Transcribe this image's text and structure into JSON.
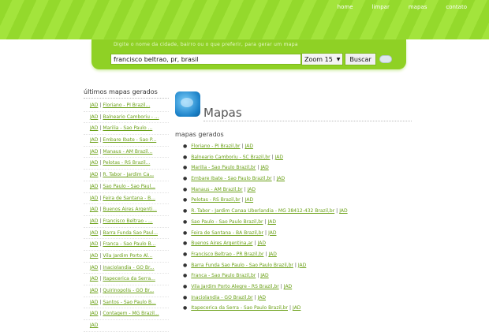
{
  "nav": [
    "home",
    "limpar",
    "mapas",
    "contato"
  ],
  "search": {
    "hint": "Digite o nome da cidade, bairro ou o que preferir, para gerar um mapa",
    "value": "francisco beltrao, pr, brasil",
    "zoom": "Zoom 15",
    "button": "Buscar"
  },
  "sidebar": {
    "title": "últimos mapas gerados",
    "link_label": "JAD",
    "items": [
      "Floriano - PI Brazil...",
      "Balneario Camboriu - ...",
      "Marilia - Sao Paulo ...",
      "Embare Ibate - Sao P...",
      "Manaus - AM Brazil...",
      "Pelotas - RS Brazil...",
      "R. Tabor - Jardim Ca...",
      "Sao Paulo - Sao Paul...",
      "Feira de Santana - B...",
      "Buenos Aires Argenti...",
      "Francisco Beltrao - ...",
      "Barra Funda Sao Paul...",
      "Franca - Sao Paulo B...",
      "Vila Jardim Porto Al...",
      "Inaciolandia - GO Br...",
      "Itapecerica da Serra...",
      "Quirinopolis - GO Br...",
      "Santos - Sao Paulo B...",
      "Contagem - MG Brazil...",
      ""
    ]
  },
  "main": {
    "title": "Mapas",
    "section": "mapas gerados",
    "link_label": "JAD",
    "items": [
      "Floriano - PI Brazil,br",
      "Balneario Camboriu - SC Brazil,br",
      "Marilia - Sao Paulo Brazil,br",
      "Embare Ibate - Sao Paulo Brazil,br",
      "Manaus - AM Brazil,br",
      "Pelotas - RS Brazil,br",
      "R. Tabor - Jardim Canaa Uberlandia - MG 38412-432 Brazil,br",
      "Sao Paulo - Sao Paulo Brazil,br",
      "Feira de Santana - BA Brazil,br",
      "Buenos Aires Argentina,ar",
      "Francisco Beltrao - PR Brazil,br",
      "Barra Funda Sao Paulo - Sao Paulo Brazil,br",
      "Franca - Sao Paulo Brazil,br",
      "Vila Jardim Porto Alegre - RS Brazil,br",
      "Inaciolandia - GO Brazil,br",
      "Itapecerica da Serra - Sao Paulo Brazil,br"
    ]
  }
}
